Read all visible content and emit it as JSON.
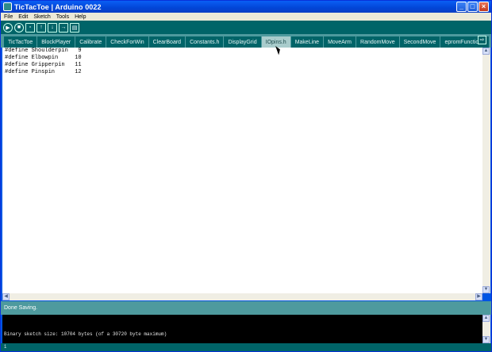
{
  "window": {
    "title": "TicTacToe | Arduino 0022"
  },
  "menu": [
    "File",
    "Edit",
    "Sketch",
    "Tools",
    "Help"
  ],
  "toolbar": {
    "buttons": [
      {
        "name": "verify",
        "icon": "play-icon",
        "glyph": "▶"
      },
      {
        "name": "stop",
        "icon": "stop-icon",
        "glyph": "■"
      },
      {
        "name": "new",
        "icon": "new-file-icon",
        "glyph": "▫"
      },
      {
        "name": "open",
        "icon": "open-icon",
        "glyph": "↑"
      },
      {
        "name": "save",
        "icon": "save-icon",
        "glyph": "↓"
      },
      {
        "name": "upload",
        "icon": "upload-icon",
        "glyph": "→"
      },
      {
        "name": "serial",
        "icon": "serial-monitor-icon",
        "glyph": "▤"
      }
    ]
  },
  "tabs": [
    {
      "label": "TicTacToe",
      "active": false
    },
    {
      "label": "BlockPlayer",
      "active": false
    },
    {
      "label": "Calibrate",
      "active": false
    },
    {
      "label": "CheckForWin",
      "active": false
    },
    {
      "label": "ClearBoard",
      "active": false
    },
    {
      "label": "Constants.h",
      "active": false
    },
    {
      "label": "DisplayGrid",
      "active": false
    },
    {
      "label": "IOpins.h",
      "active": true
    },
    {
      "label": "MakeLine",
      "active": false
    },
    {
      "label": "MoveArm",
      "active": false
    },
    {
      "label": "RandomMove",
      "active": false
    },
    {
      "label": "SecondMove",
      "active": false
    },
    {
      "label": "epromFunctions",
      "active": false
    }
  ],
  "editor": {
    "lines": [
      "#define Shoulderpin   9",
      "#define Elbowpin     10",
      "#define Gripperpin   11",
      "#define Pinspin      12"
    ]
  },
  "status": {
    "message": "Done Saving."
  },
  "console": {
    "text": "Binary sketch size: 10704 bytes (of a 30720 byte maximum)"
  },
  "linebar": {
    "line_number": "1"
  },
  "colors": {
    "toolbar": "#006468",
    "tabs_bg": "#4e9a9e",
    "active_tab": "#a9cccc",
    "titlebar": "#0245d6"
  }
}
